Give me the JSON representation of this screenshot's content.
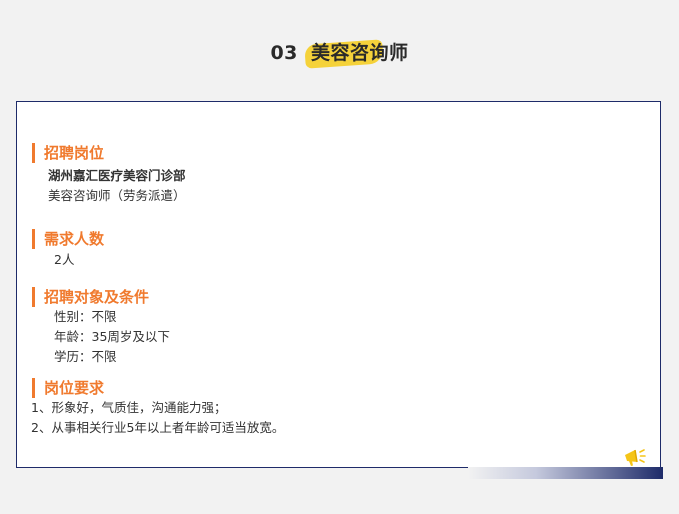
{
  "header": {
    "number": "03",
    "title": "美容咨询师"
  },
  "colors": {
    "accent": "#f07a2e",
    "border": "#1e2b69",
    "highlight": "#f5d23a"
  },
  "sections": {
    "position": {
      "title": "招聘岗位",
      "company": "湖州嘉汇医疗美容门诊部",
      "role": "美容咨询师（劳务派遣）"
    },
    "headcount": {
      "title": "需求人数",
      "value": "2人"
    },
    "conditions": {
      "title": "招聘对象及条件",
      "gender": "性别：不限",
      "age": "年龄：35周岁及以下",
      "education": "学历：不限"
    },
    "requirements": {
      "title": "岗位要求",
      "item1": "1、形象好，气质佳，沟通能力强；",
      "item2": "2、从事相关行业5年以上者年龄可适当放宽。"
    }
  },
  "decoration": {
    "icon": "megaphone-icon"
  }
}
